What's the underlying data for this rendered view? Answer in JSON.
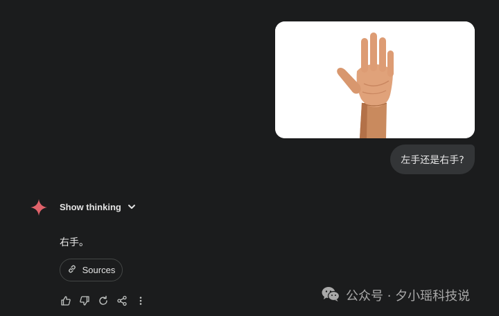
{
  "user_message": {
    "text": "左手还是右手?"
  },
  "response": {
    "show_thinking_label": "Show thinking",
    "answer_text": "右手。",
    "sources_label": "Sources"
  },
  "actions": {
    "icons": [
      "thumbs-up-icon",
      "thumbs-down-icon",
      "refresh-icon",
      "share-icon",
      "more-vert-icon"
    ]
  },
  "watermark": {
    "text": "公众号 · 夕小瑶科技说"
  },
  "colors": {
    "background": "#1b1c1d",
    "user_bubble": "#333537",
    "gemini_spark": "#e0626a",
    "text": "#e3e3e3",
    "outline": "#444746"
  }
}
